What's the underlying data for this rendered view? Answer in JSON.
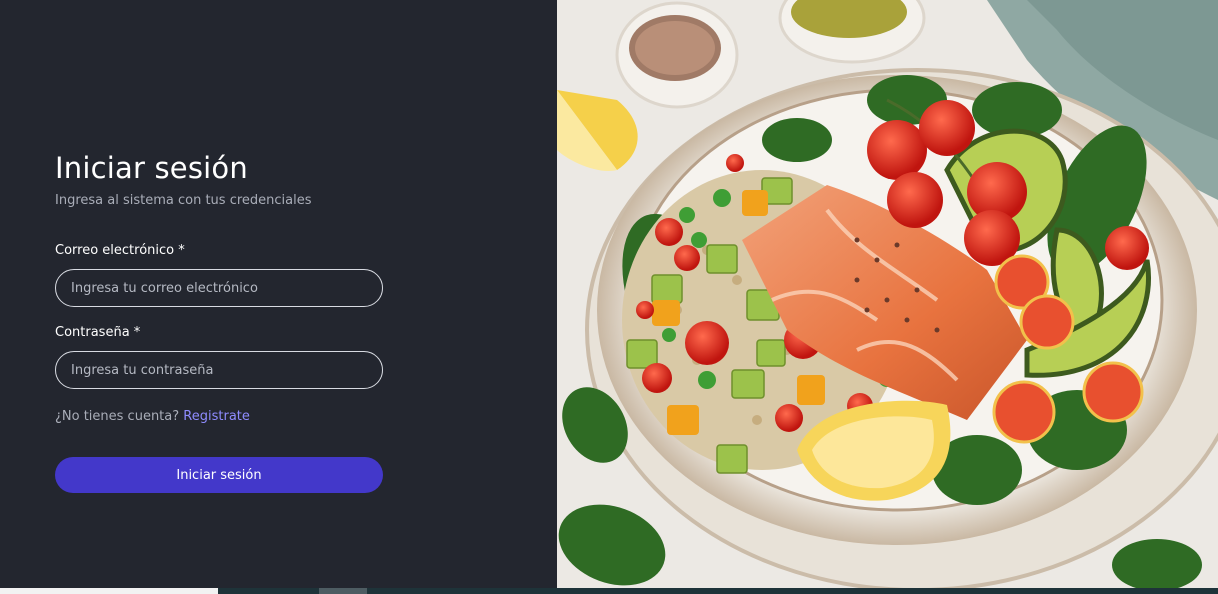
{
  "login": {
    "title": "Iniciar sesión",
    "subtitle": "Ingresa al sistema con tus credenciales",
    "email_label": "Correo electrónico *",
    "email_placeholder": "Ingresa tu correo electrónico",
    "email_value": "",
    "password_label": "Contraseña *",
    "password_placeholder": "Ingresa tu contraseña",
    "password_value": "",
    "register_prompt": "¿No tienes cuenta?",
    "register_link": "Registrate",
    "submit_label": "Iniciar sesión"
  },
  "image": {
    "subject": "salmon-quinoa-salad-bowl"
  },
  "colors": {
    "panel_bg": "#23262f",
    "accent": "#4338ca",
    "link": "#8f8cff",
    "muted_text": "#a9adb8"
  }
}
